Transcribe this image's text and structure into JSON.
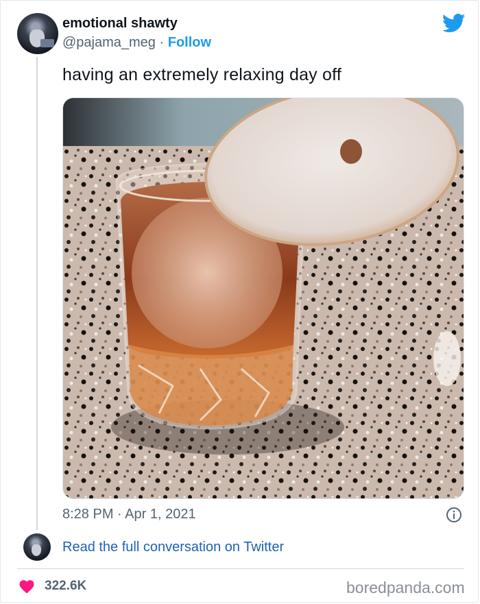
{
  "tweet": {
    "display_name": "emotional shawty",
    "handle": "@pajama_meg",
    "separator": "·",
    "follow_label": "Follow",
    "text": "having an extremely relaxing day off",
    "timestamp": "8:28 PM · Apr 1, 2021",
    "read_link": "Read the full conversation on Twitter",
    "likes": "322.6K"
  },
  "icons": {
    "brand": "twitter-bird-icon",
    "info": "info-icon",
    "like": "heart-icon"
  },
  "watermark": "boredpanda.com",
  "colors": {
    "twitter_blue": "#1d9bf0",
    "link_blue": "#1d62b4",
    "heart_red": "#f91880",
    "secondary_text": "#536471"
  }
}
